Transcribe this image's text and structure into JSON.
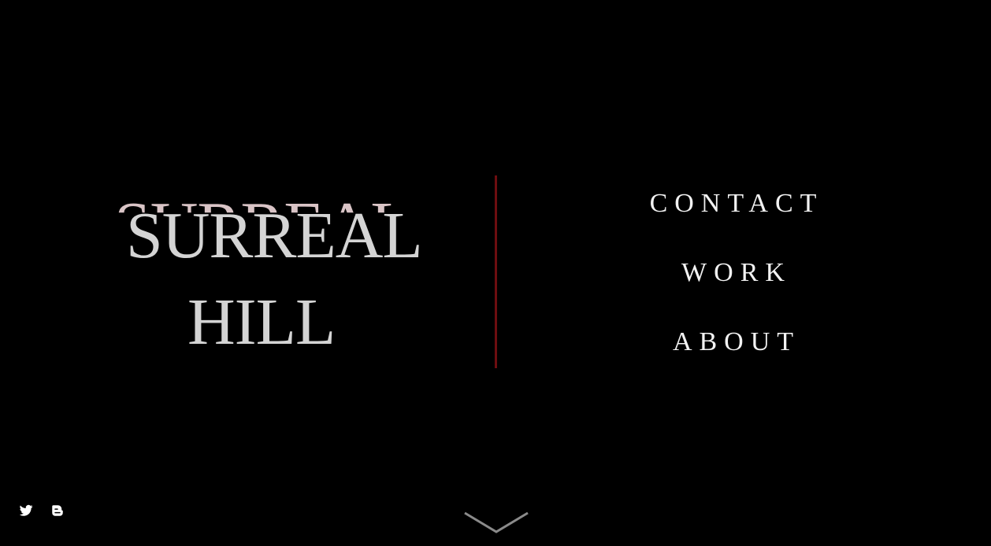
{
  "logo": {
    "line1": "SURREAL",
    "line2": "HILL",
    "ghost": "SURREAL"
  },
  "nav": {
    "items": [
      {
        "label": "CONTACT"
      },
      {
        "label": "WORK"
      },
      {
        "label": "ABOUT"
      }
    ]
  },
  "social": {
    "icons": [
      "twitter-icon",
      "blogger-icon"
    ]
  },
  "scroll": {
    "icon": "chevron-down-icon"
  },
  "colors": {
    "background": "#000000",
    "logo_text": "#d4d4d4",
    "ghost_text": "#d9c4c6",
    "divider": "#6e0d10",
    "nav_text": "#f2f2f2",
    "chevron": "#8a8a8a"
  }
}
